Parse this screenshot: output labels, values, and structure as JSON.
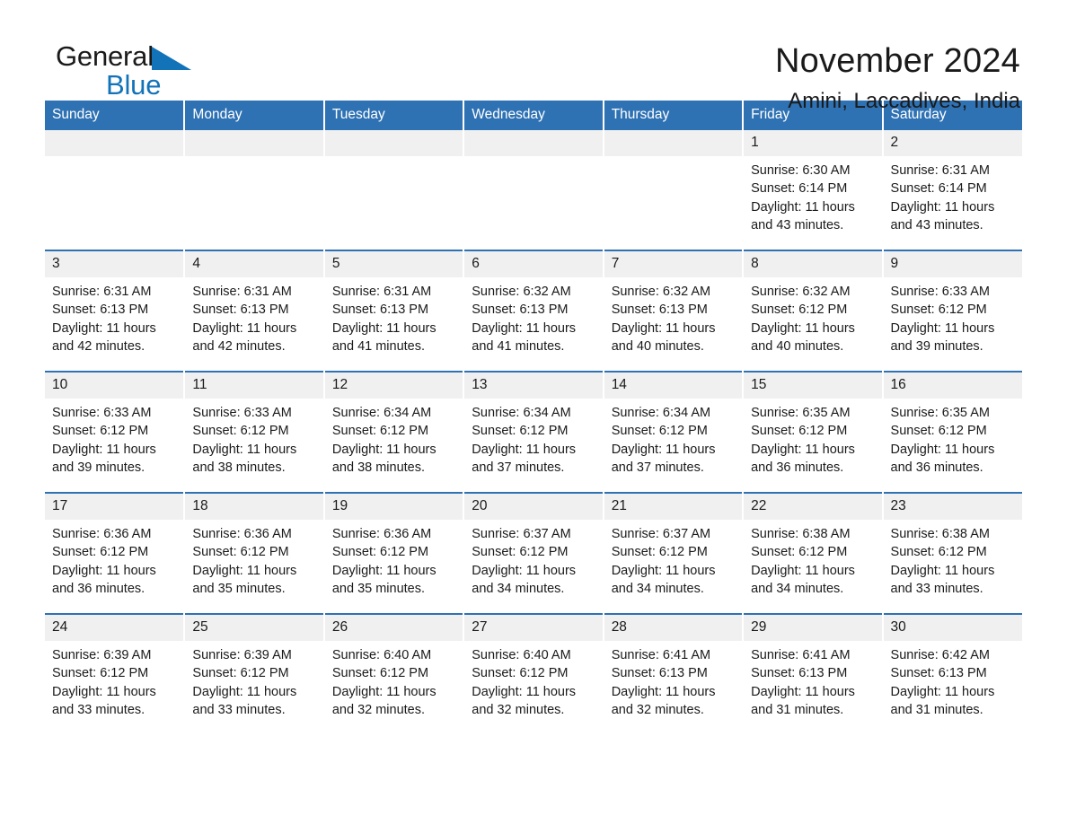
{
  "brand": {
    "name_dark": "General",
    "name_light": "Blue",
    "accent_color": "#1273b9",
    "triangle_icon": "triangle-icon"
  },
  "header": {
    "title": "November 2024",
    "location": "Amini, Laccadives, India",
    "header_bg_color": "#2f72b4",
    "daynum_bg_color": "#f0f0f0"
  },
  "weekdays": [
    "Sunday",
    "Monday",
    "Tuesday",
    "Wednesday",
    "Thursday",
    "Friday",
    "Saturday"
  ],
  "labels": {
    "sunrise_prefix": "Sunrise: ",
    "sunset_prefix": "Sunset: ",
    "daylight_prefix": "Daylight: "
  },
  "weeks": [
    [
      {
        "day": "",
        "sunrise": "",
        "sunset": "",
        "daylight_1": "",
        "daylight_2": ""
      },
      {
        "day": "",
        "sunrise": "",
        "sunset": "",
        "daylight_1": "",
        "daylight_2": ""
      },
      {
        "day": "",
        "sunrise": "",
        "sunset": "",
        "daylight_1": "",
        "daylight_2": ""
      },
      {
        "day": "",
        "sunrise": "",
        "sunset": "",
        "daylight_1": "",
        "daylight_2": ""
      },
      {
        "day": "",
        "sunrise": "",
        "sunset": "",
        "daylight_1": "",
        "daylight_2": ""
      },
      {
        "day": "1",
        "sunrise": "Sunrise: 6:30 AM",
        "sunset": "Sunset: 6:14 PM",
        "daylight_1": "Daylight: 11 hours",
        "daylight_2": "and 43 minutes."
      },
      {
        "day": "2",
        "sunrise": "Sunrise: 6:31 AM",
        "sunset": "Sunset: 6:14 PM",
        "daylight_1": "Daylight: 11 hours",
        "daylight_2": "and 43 minutes."
      }
    ],
    [
      {
        "day": "3",
        "sunrise": "Sunrise: 6:31 AM",
        "sunset": "Sunset: 6:13 PM",
        "daylight_1": "Daylight: 11 hours",
        "daylight_2": "and 42 minutes."
      },
      {
        "day": "4",
        "sunrise": "Sunrise: 6:31 AM",
        "sunset": "Sunset: 6:13 PM",
        "daylight_1": "Daylight: 11 hours",
        "daylight_2": "and 42 minutes."
      },
      {
        "day": "5",
        "sunrise": "Sunrise: 6:31 AM",
        "sunset": "Sunset: 6:13 PM",
        "daylight_1": "Daylight: 11 hours",
        "daylight_2": "and 41 minutes."
      },
      {
        "day": "6",
        "sunrise": "Sunrise: 6:32 AM",
        "sunset": "Sunset: 6:13 PM",
        "daylight_1": "Daylight: 11 hours",
        "daylight_2": "and 41 minutes."
      },
      {
        "day": "7",
        "sunrise": "Sunrise: 6:32 AM",
        "sunset": "Sunset: 6:13 PM",
        "daylight_1": "Daylight: 11 hours",
        "daylight_2": "and 40 minutes."
      },
      {
        "day": "8",
        "sunrise": "Sunrise: 6:32 AM",
        "sunset": "Sunset: 6:12 PM",
        "daylight_1": "Daylight: 11 hours",
        "daylight_2": "and 40 minutes."
      },
      {
        "day": "9",
        "sunrise": "Sunrise: 6:33 AM",
        "sunset": "Sunset: 6:12 PM",
        "daylight_1": "Daylight: 11 hours",
        "daylight_2": "and 39 minutes."
      }
    ],
    [
      {
        "day": "10",
        "sunrise": "Sunrise: 6:33 AM",
        "sunset": "Sunset: 6:12 PM",
        "daylight_1": "Daylight: 11 hours",
        "daylight_2": "and 39 minutes."
      },
      {
        "day": "11",
        "sunrise": "Sunrise: 6:33 AM",
        "sunset": "Sunset: 6:12 PM",
        "daylight_1": "Daylight: 11 hours",
        "daylight_2": "and 38 minutes."
      },
      {
        "day": "12",
        "sunrise": "Sunrise: 6:34 AM",
        "sunset": "Sunset: 6:12 PM",
        "daylight_1": "Daylight: 11 hours",
        "daylight_2": "and 38 minutes."
      },
      {
        "day": "13",
        "sunrise": "Sunrise: 6:34 AM",
        "sunset": "Sunset: 6:12 PM",
        "daylight_1": "Daylight: 11 hours",
        "daylight_2": "and 37 minutes."
      },
      {
        "day": "14",
        "sunrise": "Sunrise: 6:34 AM",
        "sunset": "Sunset: 6:12 PM",
        "daylight_1": "Daylight: 11 hours",
        "daylight_2": "and 37 minutes."
      },
      {
        "day": "15",
        "sunrise": "Sunrise: 6:35 AM",
        "sunset": "Sunset: 6:12 PM",
        "daylight_1": "Daylight: 11 hours",
        "daylight_2": "and 36 minutes."
      },
      {
        "day": "16",
        "sunrise": "Sunrise: 6:35 AM",
        "sunset": "Sunset: 6:12 PM",
        "daylight_1": "Daylight: 11 hours",
        "daylight_2": "and 36 minutes."
      }
    ],
    [
      {
        "day": "17",
        "sunrise": "Sunrise: 6:36 AM",
        "sunset": "Sunset: 6:12 PM",
        "daylight_1": "Daylight: 11 hours",
        "daylight_2": "and 36 minutes."
      },
      {
        "day": "18",
        "sunrise": "Sunrise: 6:36 AM",
        "sunset": "Sunset: 6:12 PM",
        "daylight_1": "Daylight: 11 hours",
        "daylight_2": "and 35 minutes."
      },
      {
        "day": "19",
        "sunrise": "Sunrise: 6:36 AM",
        "sunset": "Sunset: 6:12 PM",
        "daylight_1": "Daylight: 11 hours",
        "daylight_2": "and 35 minutes."
      },
      {
        "day": "20",
        "sunrise": "Sunrise: 6:37 AM",
        "sunset": "Sunset: 6:12 PM",
        "daylight_1": "Daylight: 11 hours",
        "daylight_2": "and 34 minutes."
      },
      {
        "day": "21",
        "sunrise": "Sunrise: 6:37 AM",
        "sunset": "Sunset: 6:12 PM",
        "daylight_1": "Daylight: 11 hours",
        "daylight_2": "and 34 minutes."
      },
      {
        "day": "22",
        "sunrise": "Sunrise: 6:38 AM",
        "sunset": "Sunset: 6:12 PM",
        "daylight_1": "Daylight: 11 hours",
        "daylight_2": "and 34 minutes."
      },
      {
        "day": "23",
        "sunrise": "Sunrise: 6:38 AM",
        "sunset": "Sunset: 6:12 PM",
        "daylight_1": "Daylight: 11 hours",
        "daylight_2": "and 33 minutes."
      }
    ],
    [
      {
        "day": "24",
        "sunrise": "Sunrise: 6:39 AM",
        "sunset": "Sunset: 6:12 PM",
        "daylight_1": "Daylight: 11 hours",
        "daylight_2": "and 33 minutes."
      },
      {
        "day": "25",
        "sunrise": "Sunrise: 6:39 AM",
        "sunset": "Sunset: 6:12 PM",
        "daylight_1": "Daylight: 11 hours",
        "daylight_2": "and 33 minutes."
      },
      {
        "day": "26",
        "sunrise": "Sunrise: 6:40 AM",
        "sunset": "Sunset: 6:12 PM",
        "daylight_1": "Daylight: 11 hours",
        "daylight_2": "and 32 minutes."
      },
      {
        "day": "27",
        "sunrise": "Sunrise: 6:40 AM",
        "sunset": "Sunset: 6:12 PM",
        "daylight_1": "Daylight: 11 hours",
        "daylight_2": "and 32 minutes."
      },
      {
        "day": "28",
        "sunrise": "Sunrise: 6:41 AM",
        "sunset": "Sunset: 6:13 PM",
        "daylight_1": "Daylight: 11 hours",
        "daylight_2": "and 32 minutes."
      },
      {
        "day": "29",
        "sunrise": "Sunrise: 6:41 AM",
        "sunset": "Sunset: 6:13 PM",
        "daylight_1": "Daylight: 11 hours",
        "daylight_2": "and 31 minutes."
      },
      {
        "day": "30",
        "sunrise": "Sunrise: 6:42 AM",
        "sunset": "Sunset: 6:13 PM",
        "daylight_1": "Daylight: 11 hours",
        "daylight_2": "and 31 minutes."
      }
    ]
  ]
}
